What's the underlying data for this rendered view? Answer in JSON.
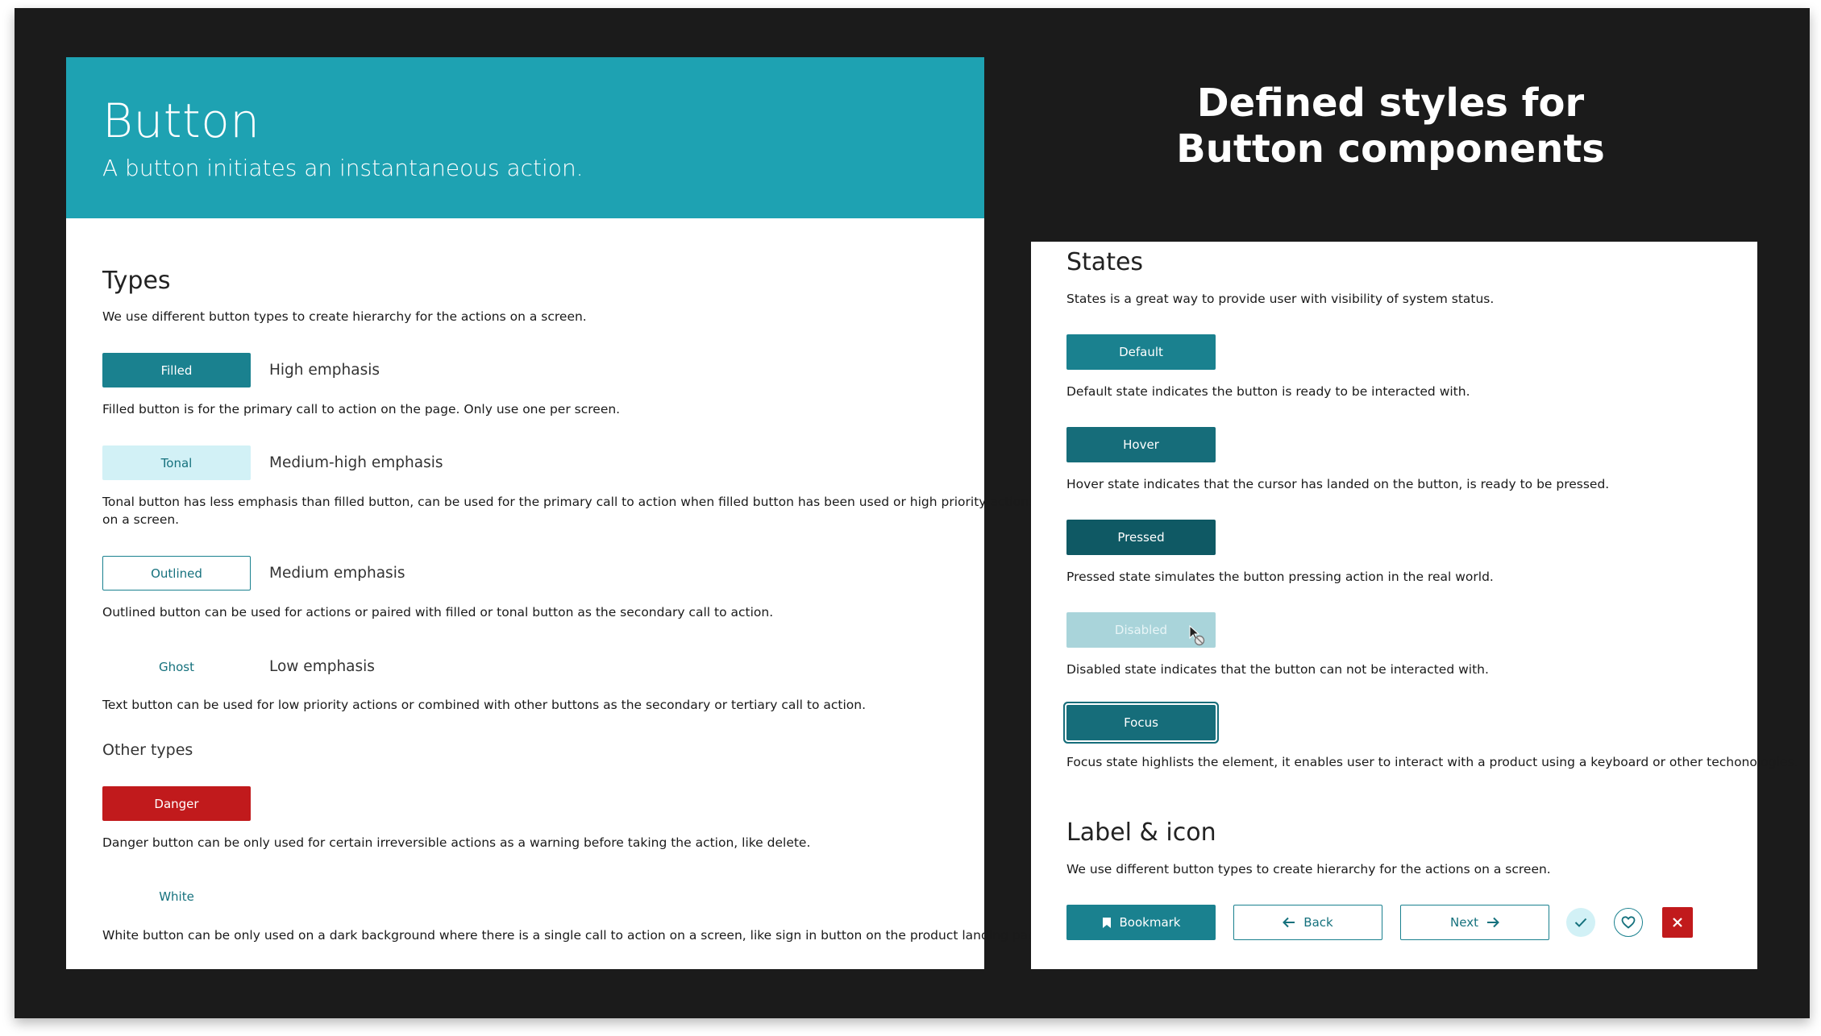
{
  "hero": {
    "title": "Button",
    "subtitle": "A button initiates an instantaneous action."
  },
  "right_heading": {
    "line1": "Defined styles for",
    "line2": "Button components"
  },
  "types": {
    "heading": "Types",
    "intro": "We use different button types to create hierarchy for the actions on a screen.",
    "filled": {
      "label": "Filled",
      "emphasis": "High emphasis",
      "desc": "Filled button is for the primary call to action on the page. Only use one per screen."
    },
    "tonal": {
      "label": "Tonal",
      "emphasis": "Medium-high emphasis",
      "desc_line1": "Tonal button has less emphasis than filled button, can be used for the primary call to action when filled button has been used or high priority actions",
      "desc_line2": "on a screen."
    },
    "outlined": {
      "label": "Outlined",
      "emphasis": "Medium emphasis",
      "desc": "Outlined button can be used for actions or paired with filled or tonal button as the secondary call to action."
    },
    "ghost": {
      "label": "Ghost",
      "emphasis": "Low emphasis",
      "desc": "Text button can be used for low priority actions or combined with other buttons as the secondary or tertiary call to action."
    },
    "other_heading": "Other types",
    "danger": {
      "label": "Danger",
      "desc": "Danger button can be only used for certain irreversible actions as a warning before taking the action, like delete."
    },
    "white": {
      "label": "White",
      "desc": "White button can be only used on a dark background where there is a single call to action on a screen, like sign in button on the product landing page."
    }
  },
  "states": {
    "heading": "States",
    "intro": "States is a great way to provide user with visibility of system status.",
    "default": {
      "label": "Default",
      "desc": "Default state indicates the button is ready to be interacted with."
    },
    "hover": {
      "label": "Hover",
      "desc": "Hover state indicates that the cursor has landed on the button, is ready to be pressed."
    },
    "pressed": {
      "label": "Pressed",
      "desc": "Pressed state simulates the button pressing action in the real world."
    },
    "disabled": {
      "label": "Disabled",
      "desc": "Disabled state indicates that the button can not be interacted with."
    },
    "focus": {
      "label": "Focus",
      "desc": "Focus state highlists the element, it enables user to interact with a product using a keyboard or other techonologies."
    }
  },
  "label_icon": {
    "heading": "Label & icon",
    "intro": "We use different button types to create hierarchy for the actions on a screen.",
    "bookmark_label": "Bookmark",
    "back_label": "Back",
    "next_label": "Next"
  },
  "colors": {
    "background": "#1b1b1b",
    "hero": "#1ea2b2",
    "primary": "#1a818f",
    "tonal": "#d2f1f6",
    "danger": "#c11a1c",
    "disabled": "#a9d4da"
  },
  "icons": [
    "bookmark-icon",
    "arrow-left-icon",
    "arrow-right-icon",
    "check-icon",
    "heart-icon",
    "close-icon",
    "cursor-not-allowed-icon"
  ]
}
